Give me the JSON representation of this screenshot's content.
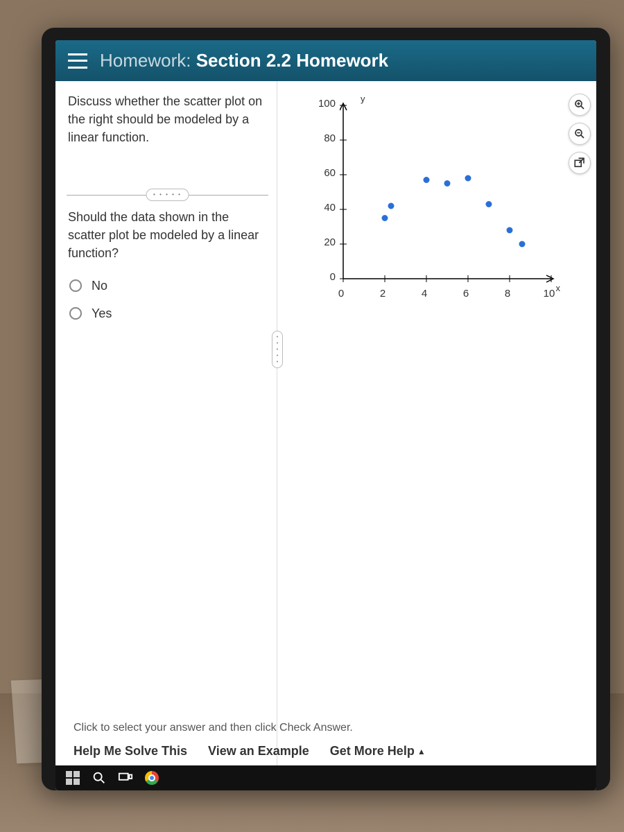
{
  "header": {
    "title_prefix": "Homework: ",
    "title_main": "Section 2.2 Homework"
  },
  "prompt": "Discuss whether the scatter plot on the right should be modeled by a linear function.",
  "question": "Should the data shown in the scatter plot be modeled by a linear function?",
  "options": [
    {
      "label": "No"
    },
    {
      "label": "Yes"
    }
  ],
  "hint": "Click to select your answer and then click Check Answer.",
  "help_links": {
    "solve": "Help Me Solve This",
    "example": "View an Example",
    "more": "Get More Help"
  },
  "chart_data": {
    "type": "scatter",
    "title": "",
    "xlabel": "x",
    "ylabel": "y",
    "xlim": [
      0,
      10
    ],
    "ylim": [
      0,
      100
    ],
    "x_ticks": [
      0,
      2,
      4,
      6,
      8,
      10
    ],
    "y_ticks": [
      0,
      20,
      40,
      60,
      80,
      100
    ],
    "series": [
      {
        "name": "points",
        "x": [
          2,
          2.3,
          4,
          5,
          6,
          7,
          8,
          8.6
        ],
        "y": [
          35,
          42,
          57,
          55,
          58,
          43,
          28,
          20
        ]
      }
    ]
  }
}
